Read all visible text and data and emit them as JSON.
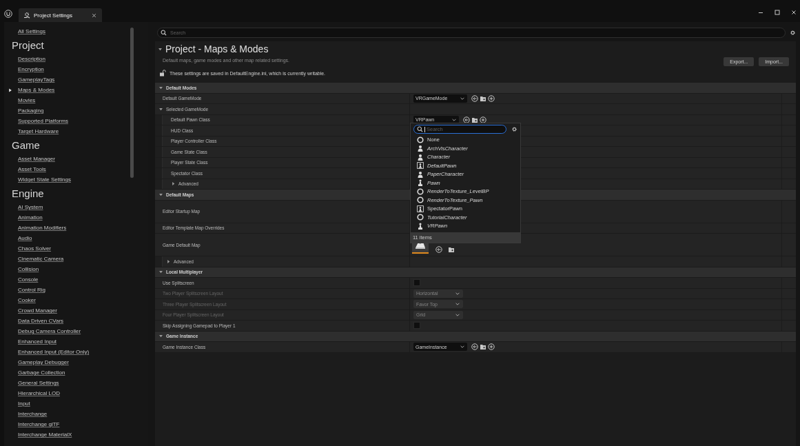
{
  "window": {
    "tab_title": "Project Settings"
  },
  "sidebar": {
    "items": [
      {
        "kind": "link",
        "label": "All Settings",
        "selected": false
      },
      {
        "kind": "heading",
        "label": "Project"
      },
      {
        "kind": "link",
        "label": "Description",
        "selected": false
      },
      {
        "kind": "link",
        "label": "Encryption",
        "selected": false
      },
      {
        "kind": "link",
        "label": "GameplayTags",
        "selected": false
      },
      {
        "kind": "link",
        "label": "Maps & Modes",
        "selected": true
      },
      {
        "kind": "link",
        "label": "Movies",
        "selected": false
      },
      {
        "kind": "link",
        "label": "Packaging",
        "selected": false
      },
      {
        "kind": "link",
        "label": "Supported Platforms",
        "selected": false
      },
      {
        "kind": "link",
        "label": "Target Hardware",
        "selected": false
      },
      {
        "kind": "heading",
        "label": "Game"
      },
      {
        "kind": "link",
        "label": "Asset Manager",
        "selected": false
      },
      {
        "kind": "link",
        "label": "Asset Tools",
        "selected": false
      },
      {
        "kind": "link",
        "label": "Widget State Settings",
        "selected": false
      },
      {
        "kind": "heading",
        "label": "Engine"
      },
      {
        "kind": "link",
        "label": "AI System",
        "selected": false
      },
      {
        "kind": "link",
        "label": "Animation",
        "selected": false
      },
      {
        "kind": "link",
        "label": "Animation Modifiers",
        "selected": false
      },
      {
        "kind": "link",
        "label": "Audio",
        "selected": false
      },
      {
        "kind": "link",
        "label": "Chaos Solver",
        "selected": false
      },
      {
        "kind": "link",
        "label": "Cinematic Camera",
        "selected": false
      },
      {
        "kind": "link",
        "label": "Collision",
        "selected": false
      },
      {
        "kind": "link",
        "label": "Console",
        "selected": false
      },
      {
        "kind": "link",
        "label": "Control Rig",
        "selected": false
      },
      {
        "kind": "link",
        "label": "Cooker",
        "selected": false
      },
      {
        "kind": "link",
        "label": "Crowd Manager",
        "selected": false
      },
      {
        "kind": "link",
        "label": "Data Driven CVars",
        "selected": false
      },
      {
        "kind": "link",
        "label": "Debug Camera Controller",
        "selected": false
      },
      {
        "kind": "link",
        "label": "Enhanced Input",
        "selected": false
      },
      {
        "kind": "link",
        "label": "Enhanced Input (Editor Only)",
        "selected": false
      },
      {
        "kind": "link",
        "label": "Gameplay Debugger",
        "selected": false
      },
      {
        "kind": "link",
        "label": "Garbage Collection",
        "selected": false
      },
      {
        "kind": "link",
        "label": "General Settings",
        "selected": false
      },
      {
        "kind": "link",
        "label": "Hierarchical LOD",
        "selected": false
      },
      {
        "kind": "link",
        "label": "Input",
        "selected": false
      },
      {
        "kind": "link",
        "label": "Interchange",
        "selected": false
      },
      {
        "kind": "link",
        "label": "Interchange glTF",
        "selected": false
      },
      {
        "kind": "link",
        "label": "Interchange MaterialX",
        "selected": false
      }
    ]
  },
  "search": {
    "placeholder": "Search"
  },
  "header": {
    "title": "Project - Maps & Modes",
    "description": "Default maps, game modes and other map related settings.",
    "note": "These settings are saved in DefaultEngine.ini, which is currently writable.",
    "buttons": [
      "Export...",
      "Import..."
    ]
  },
  "sections": [
    {
      "title": "Default Modes",
      "expanded": true,
      "rows": [
        {
          "kind": "class",
          "label": "Default GameMode",
          "value": "VRGameMode",
          "picker_open": false
        },
        {
          "kind": "group",
          "label": "Selected GameMode",
          "expanded": true,
          "children": [
            {
              "kind": "class",
              "label": "Default Pawn Class",
              "value": "VRPawn",
              "picker_open": true
            },
            {
              "kind": "plain",
              "label": "HUD Class"
            },
            {
              "kind": "plain",
              "label": "Player Controller Class"
            },
            {
              "kind": "plain",
              "label": "Game State Class"
            },
            {
              "kind": "plain",
              "label": "Player State Class"
            },
            {
              "kind": "plain",
              "label": "Spectator Class"
            },
            {
              "kind": "advanced",
              "label": "Advanced",
              "expanded": false
            }
          ]
        }
      ]
    },
    {
      "title": "Default Maps",
      "expanded": true,
      "rows": [
        {
          "kind": "plain_tall",
          "label": "Editor Startup Map"
        },
        {
          "kind": "plain",
          "label": "Editor Template Map Overrides"
        },
        {
          "kind": "map",
          "label": "Game Default Map"
        },
        {
          "kind": "advanced",
          "label": "Advanced",
          "expanded": false
        }
      ]
    },
    {
      "title": "Local Multiplayer",
      "expanded": true,
      "rows": [
        {
          "kind": "checkbox",
          "label": "Use Splitscreen",
          "checked": false,
          "disabled": false
        },
        {
          "kind": "enum",
          "label": "Two Player Splitscreen Layout",
          "value": "Horizontal",
          "disabled": true
        },
        {
          "kind": "enum",
          "label": "Three Player Splitscreen Layout",
          "value": "Favor Top",
          "disabled": true
        },
        {
          "kind": "enum",
          "label": "Four Player Splitscreen Layout",
          "value": "Grid",
          "disabled": true
        },
        {
          "kind": "checkbox",
          "label": "Skip Assigning Gamepad to Player 1",
          "checked": false,
          "disabled": false
        }
      ]
    },
    {
      "title": "Game Instance",
      "expanded": true,
      "rows": [
        {
          "kind": "class",
          "label": "Game Instance Class",
          "value": "GameInstance",
          "picker_open": false
        }
      ]
    }
  ],
  "class_picker": {
    "placeholder": "Search",
    "footer": "11 items",
    "items": [
      {
        "label": "None",
        "kind": "ring",
        "italic": false
      },
      {
        "label": "ArchVisCharacter",
        "kind": "figure",
        "italic": true
      },
      {
        "label": "Character",
        "kind": "figure",
        "italic": true
      },
      {
        "label": "DefaultPawn",
        "kind": "boxed",
        "italic": true
      },
      {
        "label": "PaperCharacter",
        "kind": "figure",
        "italic": true
      },
      {
        "label": "Pawn",
        "kind": "pawn",
        "italic": true
      },
      {
        "label": "RenderToTexture_LevelBP",
        "kind": "ring",
        "italic": true
      },
      {
        "label": "RenderToTexture_Pawn",
        "kind": "ring",
        "italic": true
      },
      {
        "label": "SpectatorPawn",
        "kind": "boxed",
        "italic": false
      },
      {
        "label": "TutorialCharacter",
        "kind": "ring",
        "italic": true
      },
      {
        "label": "VRPawn",
        "kind": "pawn",
        "italic": true
      }
    ]
  }
}
